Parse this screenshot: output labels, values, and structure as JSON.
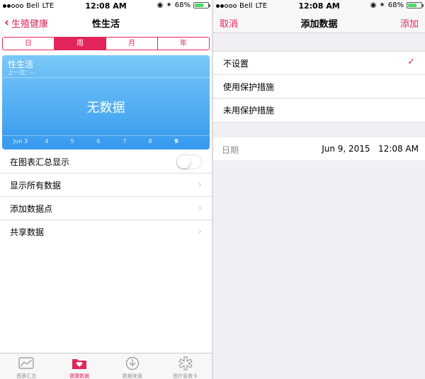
{
  "colors": {
    "accent": "#e2255a",
    "chart_top": "#79c8f7",
    "chart_bottom": "#3599ef",
    "battery": "#4cd964"
  },
  "status_bar": {
    "carrier": "Bell",
    "network": "LTE",
    "time": "12:08 AM",
    "battery": "68%",
    "battery_level": 0.68
  },
  "left": {
    "nav": {
      "back_label": "生殖健康",
      "title": "性生活"
    },
    "segments": [
      "日",
      "周",
      "月",
      "年"
    ],
    "selected_segment": "周",
    "chart": {
      "title": "性生活",
      "subtitle": "上一次：--",
      "empty_text": "无数据",
      "x_ticks": [
        "Jun 3",
        "4",
        "5",
        "6",
        "7",
        "8",
        "9"
      ]
    },
    "rows": {
      "show_in_dashboard": "在图表汇总显示",
      "show_all_data": "显示所有数据",
      "add_data_point": "添加数据点",
      "share_data": "共享数据"
    },
    "toggle_on": false,
    "tabs": [
      {
        "label": "图表汇总",
        "icon": "dashboard-icon"
      },
      {
        "label": "健康数据",
        "icon": "health-data-icon"
      },
      {
        "label": "数据来源",
        "icon": "sources-icon"
      },
      {
        "label": "医疗急救卡",
        "icon": "medical-id-icon"
      }
    ],
    "active_tab": "健康数据"
  },
  "right": {
    "nav": {
      "cancel_label": "取消",
      "title": "添加数据",
      "add_label": "添加"
    },
    "options": [
      "不设置",
      "使用保护措施",
      "未用保护措施"
    ],
    "selected_option": "不设置",
    "date_label": "日期",
    "date_value": "Jun 9, 2015",
    "time_value": "12:08 AM"
  }
}
